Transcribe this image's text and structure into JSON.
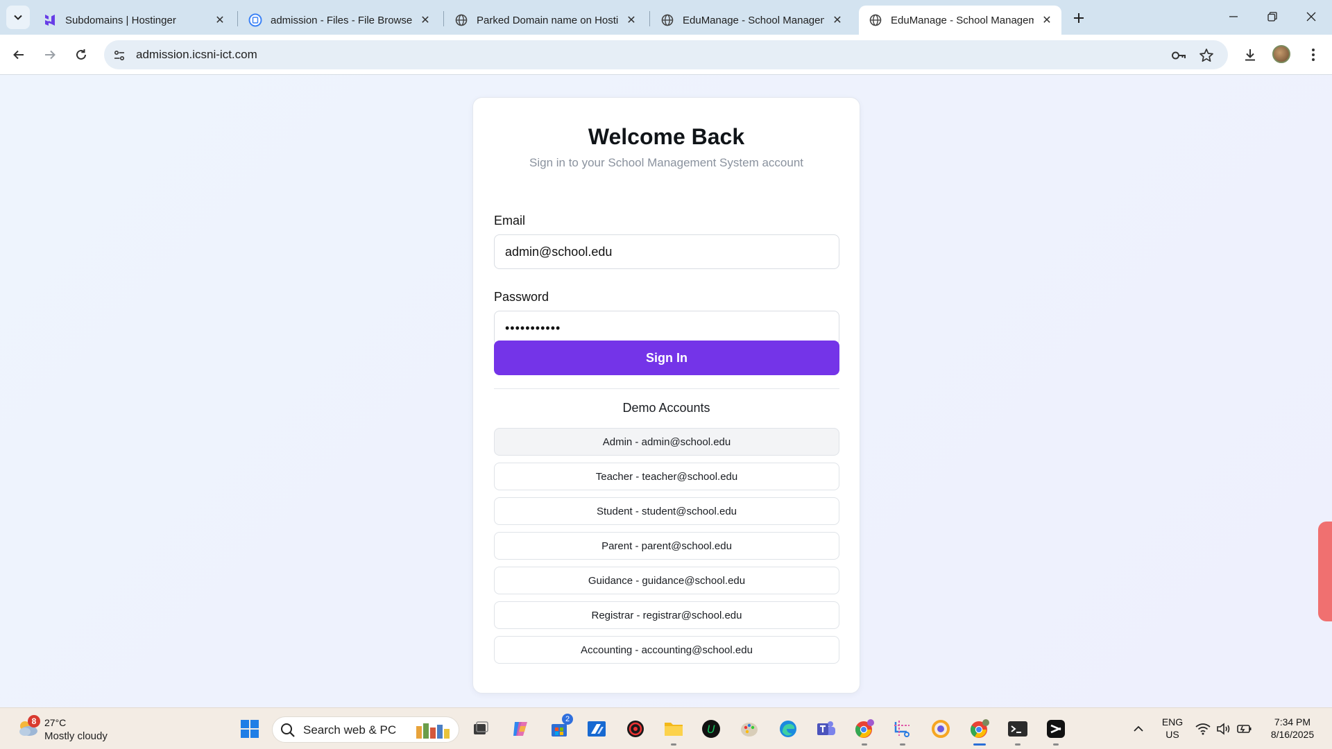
{
  "browser": {
    "tabs": [
      {
        "title": "Subdomains | Hostinger",
        "favicon": "hostinger-icon"
      },
      {
        "title": "admission - Files - File Browser",
        "favicon": "file-browser-icon"
      },
      {
        "title": "Parked Domain name on Hostinger",
        "favicon": "globe-icon"
      },
      {
        "title": "EduManage - School Management",
        "favicon": "globe-icon"
      },
      {
        "title": "EduManage - School Management",
        "favicon": "globe-icon",
        "active": true
      }
    ],
    "url": "admission.icsni-ict.com"
  },
  "login": {
    "title": "Welcome Back",
    "subtitle": "Sign in to your School Management System account",
    "email_label": "Email",
    "email_value": "admin@school.edu",
    "password_label": "Password",
    "password_value": "•••••••••••",
    "signin_label": "Sign In",
    "demo_title": "Demo Accounts",
    "demo_accounts": [
      "Admin - admin@school.edu",
      "Teacher - teacher@school.edu",
      "Student - student@school.edu",
      "Parent - parent@school.edu",
      "Guidance - guidance@school.edu",
      "Registrar - registrar@school.edu",
      "Accounting - accounting@school.edu"
    ]
  },
  "taskbar": {
    "weather": {
      "badge": "8",
      "temp": "27°C",
      "desc": "Mostly cloudy"
    },
    "search_placeholder": "Search web & PC",
    "store_badge": "2",
    "lang_top": "ENG",
    "lang_bottom": "US",
    "time": "7:34 PM",
    "date": "8/16/2025"
  },
  "colors": {
    "accent": "#7434e8",
    "tabstrip": "#d3e3f0",
    "taskbar": "#f3ece4"
  }
}
